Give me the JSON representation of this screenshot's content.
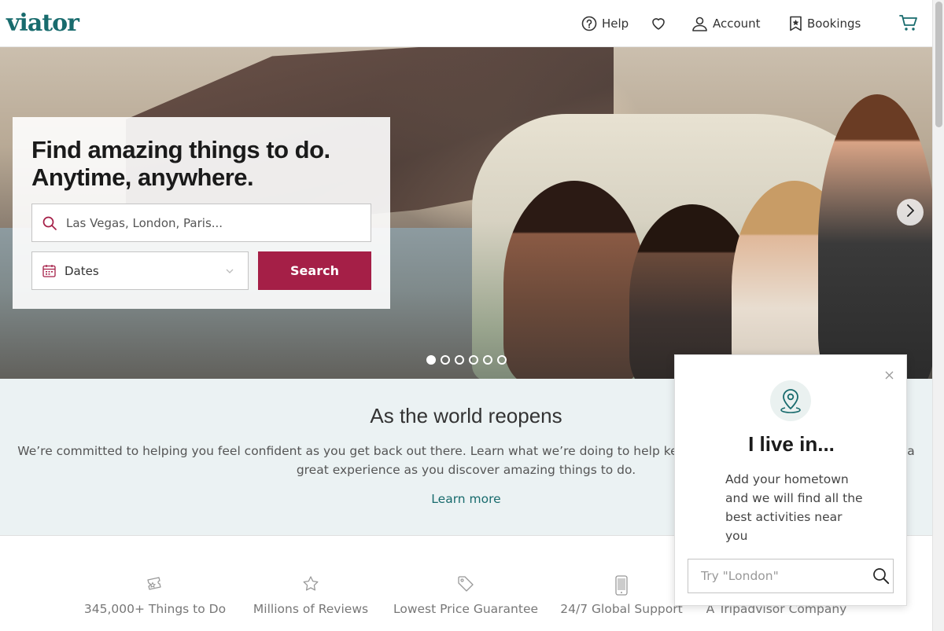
{
  "header": {
    "logo": "viator",
    "nav": {
      "help": "Help",
      "account": "Account",
      "bookings": "Bookings"
    }
  },
  "hero": {
    "title_line1": "Find amazing things to do.",
    "title_line2": "Anytime, anywhere.",
    "search_placeholder": "Las Vegas, London, Paris...",
    "dates_label": "Dates",
    "search_button": "Search",
    "slide_count": 6,
    "active_slide": 1
  },
  "reopen": {
    "title": "As the world reopens",
    "text": "We’re committed to helping you feel confident as you get back out there. Learn what we’re doing to help keep you safe and make sure you have a great experience as you discover amazing things to do.",
    "link": "Learn more"
  },
  "features": [
    {
      "icon": "ticket-icon",
      "label": "345,000+ Things to Do"
    },
    {
      "icon": "star-icon",
      "label": "Millions of Reviews"
    },
    {
      "icon": "price-tag-icon",
      "label": "Lowest Price Guarantee"
    },
    {
      "icon": "phone-icon",
      "label": "24/7 Global Support"
    },
    {
      "icon": "tripadvisor-icon",
      "label": "A Tripadvisor Company"
    }
  ],
  "popup": {
    "title": "I live in...",
    "text": "Add your hometown and we will find all the best activities near you",
    "input_placeholder": "Try \"London\""
  },
  "colors": {
    "brand": "#186b6d",
    "accent": "#a51f47",
    "section_bg": "#ebf2f3"
  }
}
